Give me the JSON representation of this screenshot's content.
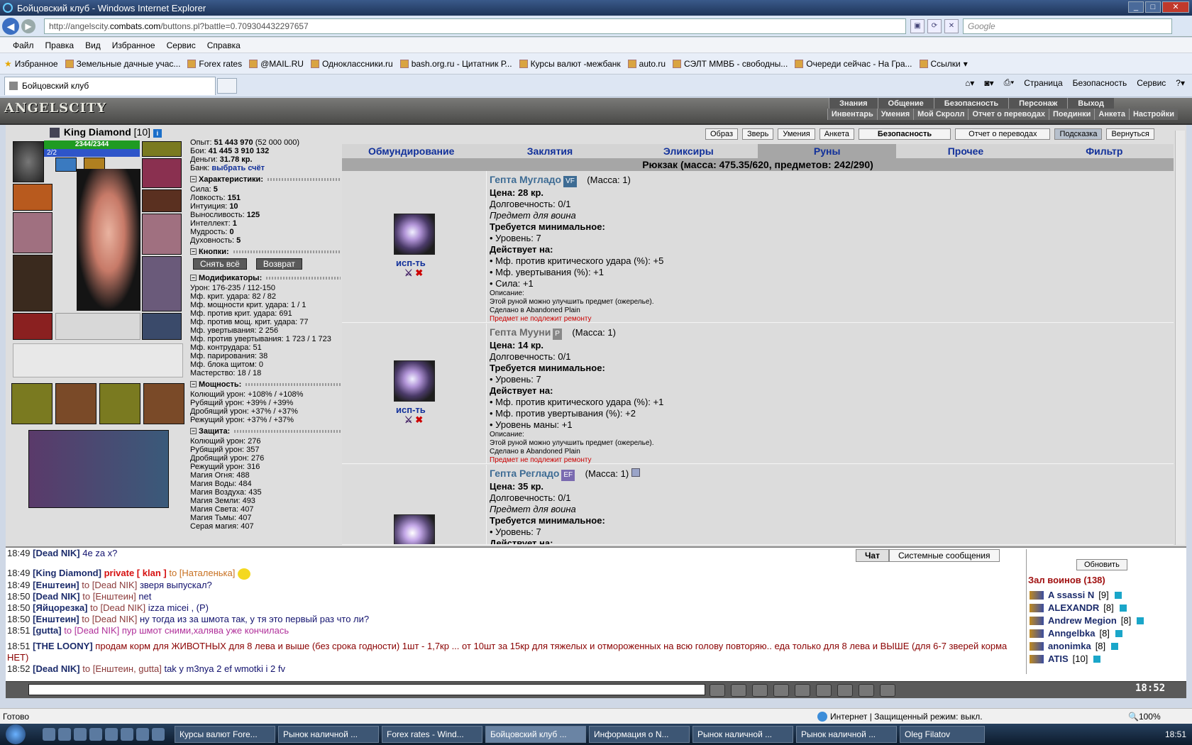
{
  "browser": {
    "title": "Бойцовский клуб - Windows Internet Explorer",
    "url_prefix": "http://angelscity.",
    "url_domain": "combats.com",
    "url_rest": "/buttons.pl?battle=0.709304432297657",
    "search_placeholder": "Google",
    "menu": [
      "Файл",
      "Правка",
      "Вид",
      "Избранное",
      "Сервис",
      "Справка"
    ],
    "favorites_label": "Избранное",
    "favorites": [
      "Земельные дачные учас...",
      "Forex rates",
      "@MAIL.RU",
      "Одноклассники.ru",
      "bash.org.ru - Цитатник Р...",
      "Курсы валют -межбанк",
      "auto.ru",
      "СЭЛТ ММВБ - свободны...",
      "Очереди сейчас - На Гра...",
      "Ссылки"
    ],
    "tab_title": "Бойцовский клуб",
    "cmd": [
      "Страница",
      "Безопасность",
      "Сервис"
    ],
    "status_left": "Готово",
    "status_zone": "Интернет | Защищенный режим: выкл.",
    "zoom": "100%"
  },
  "game": {
    "logo": "ANGELSCITY",
    "menu_top": [
      "Знания",
      "Общение",
      "Безопасность",
      "Персонаж",
      "Выход"
    ],
    "menu_sub": [
      "Инвентарь",
      "Умения",
      "Мой Скролл",
      "Отчет о переводах",
      "Поединки",
      "Анкета",
      "Настройки"
    ],
    "char": {
      "name": "King Diamond",
      "level": "[10]",
      "hp": "2344/2344",
      "mp": "2/2"
    },
    "info": {
      "exp_label": "Опыт:",
      "exp": "51 443 970",
      "exp_next": "(52 000 000)",
      "fights_label": "Бои:",
      "wins": "41 445",
      "losses": "3 910",
      "draws": "132",
      "money_label": "Деньги:",
      "money": "31.78 кр.",
      "bank_label": "Банк:",
      "bank_link": "выбрать счёт"
    },
    "sections": {
      "chars": "Характеристики:",
      "buttons": "Кнопки:",
      "mods": "Модификаторы:",
      "power": "Мощность:",
      "defense": "Защита:"
    },
    "stats": [
      {
        "k": "Сила:",
        "v": "5"
      },
      {
        "k": "Ловкость:",
        "v": "151"
      },
      {
        "k": "Интуиция:",
        "v": "10"
      },
      {
        "k": "Выносливость:",
        "v": "125"
      },
      {
        "k": "Интеллект:",
        "v": "1"
      },
      {
        "k": "Мудрость:",
        "v": "0"
      },
      {
        "k": "Духовность:",
        "v": "5"
      }
    ],
    "btn_undress": "Снять всё",
    "btn_return": "Возврат",
    "mods": [
      "Урон: 176-235 / 112-150",
      "Мф. крит. удара: 82 / 82",
      "Мф. мощности крит. удара: 1 / 1",
      "Мф. против крит. удара: 691",
      "Мф. против мощ. крит. удара: 77",
      "Мф. увертывания: 2 256",
      "Мф. против увертывания: 1 723 / 1 723",
      "Мф. контрудара: 51",
      "Мф. парирования: 38",
      "Мф. блока щитом: 0",
      "Мастерство: 18 / 18"
    ],
    "power": [
      "Колющий урон: +108% / +108%",
      "Рубящий урон: +39% / +39%",
      "Дробящий урон: +37% / +37%",
      "Режущий урон: +37% / +37%"
    ],
    "defense": [
      "Колющий урон: 276",
      "Рубящий урон: 357",
      "Дробящий урон: 276",
      "Режущий урон: 316",
      "Магия Огня: 488",
      "Магия Воды: 484",
      "Магия Воздуха: 435",
      "Магия Земли: 493",
      "Магия Света: 407",
      "Магия Тьмы: 407",
      "Серая магия: 407"
    ],
    "top_buttons": [
      "Образ",
      "Зверь",
      "Умения",
      "Анкета",
      "Безопасность",
      "Отчет о переводах",
      "Подсказка",
      "Вернуться"
    ],
    "categories": [
      "Обмундирование",
      "Заклятия",
      "Эликсиры",
      "Руны",
      "Прочее",
      "Фильтр"
    ],
    "backpack": "Рюкзак (масса: 475.35/620, предметов: 242/290)",
    "use_label": "исп-ть",
    "items": [
      {
        "name": "Гепта Мугладо",
        "tag": "VF",
        "mass": "(Масса: 1)",
        "price": "Цена: 28 кр.",
        "dur": "Долговечность: 0/1",
        "for": "Предмет для воина",
        "req": "Требуется минимальное:",
        "lvl": "• Уровень: 7",
        "acts": "Действует на:",
        "e1": "• Мф. против критического удара (%): +5",
        "e2": "• Мф. увертывания (%): +1",
        "e3": "• Сила: +1",
        "dlabel": "Описание:",
        "d1": "Этой руной можно улучшить предмет (ожерелье).",
        "d2": "Сделано в Abandoned Plain",
        "norep": "Предмет не подлежит ремонту"
      },
      {
        "name": "Гепта Мууни",
        "tag": "P",
        "mass": "(Масса: 1)",
        "price": "Цена: 14 кр.",
        "dur": "Долговечность: 0/1",
        "req": "Требуется минимальное:",
        "lvl": "• Уровень: 7",
        "acts": "Действует на:",
        "e1": "• Мф. против критического удара (%): +1",
        "e2": "• Мф. против увертывания (%): +2",
        "e3": "• Уровень маны: +1",
        "dlabel": "Описание:",
        "d1": "Этой руной можно улучшить предмет (ожерелье).",
        "d2": "Сделано в Abandoned Plain",
        "norep": "Предмет не подлежит ремонту"
      },
      {
        "name": "Гепта Регладо",
        "tag": "EF",
        "mass": "(Масса: 1)",
        "price": "Цена: 35 кр.",
        "dur": "Долговечность: 0/1",
        "for": "Предмет для воина",
        "req": "Требуется минимальное:",
        "lvl": "• Уровень: 7",
        "acts": "Действует на:"
      }
    ]
  },
  "chat": {
    "tabs": [
      "Чат",
      "Системные сообщения"
    ],
    "lines": [
      {
        "t": "18:49",
        "n": "[Dead NIK]",
        "m": "4e za x?"
      },
      {
        "t": "18:49",
        "n": "[King Diamond]",
        "p": "private [ klan ]",
        "to": "to [Наталенька]"
      },
      {
        "t": "18:49",
        "n": "[Енштеин]",
        "to": "to [Dead NIK]",
        "m": "зверя выпускал?"
      },
      {
        "t": "18:50",
        "n": "[Dead NIK]",
        "to": "to [Енштеин]",
        "m": "net"
      },
      {
        "t": "18:50",
        "n": "[Яйцорезка]",
        "to": "to [Dead NIK]",
        "m": "izza micei , (P)"
      },
      {
        "t": "18:50",
        "n": "[Енштеин]",
        "to": "to [Dead NIK]",
        "m": "ну тогда из за шмота так, у тя это первый раз что ли?"
      },
      {
        "t": "18:51",
        "n": "[gutta]",
        "pk": "to [Dead NIK] пур шмот сними,халява уже кончилась"
      },
      {
        "t": "18:51",
        "n": "[THE LOONY]",
        "dk": "продам корм для ЖИВОТНЫХ для 8 лева и выше (без срока годности)  1шт - 1,7кр ... от 10шт за 15кр для тяжелых и отмороженных на всю голову повторяю.. еда только для 8 лева и ВЫШЕ (для 6-7 зверей корма НЕТ)"
      },
      {
        "t": "18:52",
        "n": "[Dead NIK]",
        "to": "to [Енштеин, gutta]",
        "m": "tak y m3nya 2 ef wmotki i 2 fv"
      }
    ],
    "refresh": "Обновить",
    "room_title": "Зал воинов (138)",
    "players": [
      {
        "n": "A ssassi N",
        "l": "[9]"
      },
      {
        "n": "ALEXANDR",
        "l": "[8]"
      },
      {
        "n": "Andrew Megion",
        "l": "[8]"
      },
      {
        "n": "Anngelbka",
        "l": "[8]"
      },
      {
        "n": "anonimka",
        "l": "[8]"
      },
      {
        "n": "ATIS",
        "l": "[10]"
      }
    ],
    "clock": "18:52"
  },
  "taskbar": {
    "tasks": [
      "Курсы валют Fore...",
      "Рынок наличной ...",
      "Forex rates - Wind...",
      "Бойцовский клуб ...",
      "Информация о N...",
      "Рынок наличной ...",
      "Рынок наличной ...",
      "Oleg Filatov"
    ],
    "time": "18:51"
  }
}
